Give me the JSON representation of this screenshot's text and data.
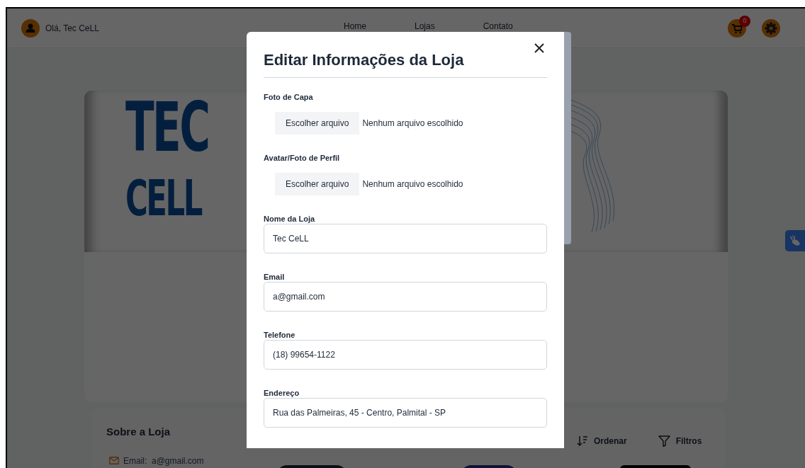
{
  "header": {
    "greeting": "Olá, Tec CeLL",
    "nav": [
      "Home",
      "Lojas",
      "Contato"
    ],
    "cart_count": "0"
  },
  "banner": {
    "logo_lines": [
      "TEC",
      "CELL"
    ]
  },
  "about": {
    "title": "Sobre a Loja",
    "email_label": "Email:",
    "email": "a@gmail.com"
  },
  "toolbar": [
    {
      "kind": "sort",
      "label": "Ordenar"
    },
    {
      "kind": "filter",
      "label": "Filtros"
    }
  ],
  "modal": {
    "title": "Editar Informações da Loja",
    "fields": [
      {
        "kind": "file",
        "label": "Foto de Capa",
        "button": "Escolher arquivo",
        "status": "Nenhum arquivo escolhido"
      },
      {
        "kind": "file",
        "label": "Avatar/Foto de Perfil",
        "button": "Escolher arquivo",
        "status": "Nenhum arquivo escolhido"
      },
      {
        "kind": "text",
        "label": "Nome da Loja",
        "value": "Tec CeLL"
      },
      {
        "kind": "text",
        "label": "Email",
        "value": "a@gmail.com"
      },
      {
        "kind": "text",
        "label": "Telefone",
        "value": "(18) 99654-1122"
      },
      {
        "kind": "text",
        "label": "Endereço",
        "value": "Rua das Palmeiras, 45 - Centro, Palmital - SP"
      }
    ]
  }
}
